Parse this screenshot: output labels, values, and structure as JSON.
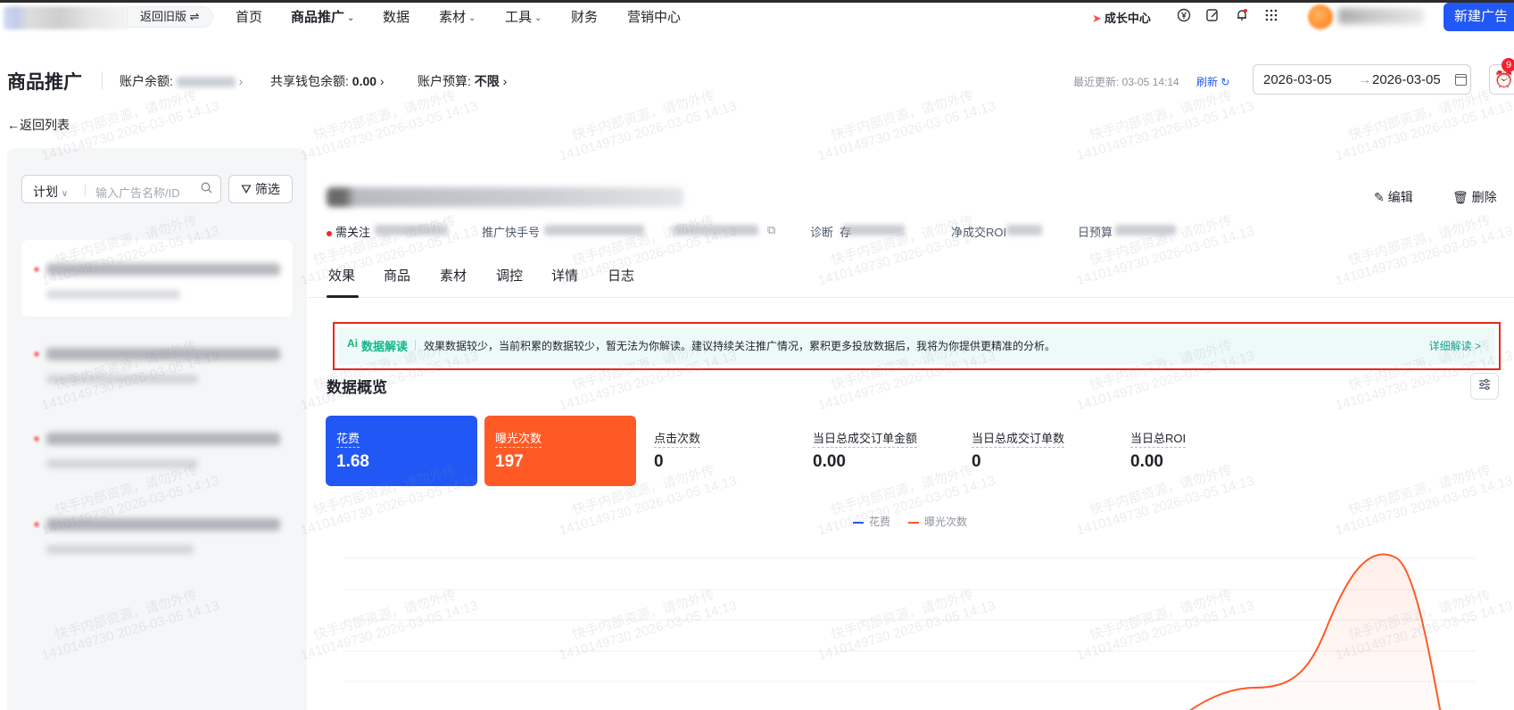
{
  "topnav": {
    "old_version": "返回旧版 ⇌",
    "items": [
      "首页",
      "商品推广",
      "数据",
      "素材",
      "工具",
      "财务",
      "营销中心"
    ],
    "growth_center": "成长中心",
    "new_ad": "新建广告"
  },
  "header": {
    "title": "商品推广",
    "account_balance_label": "账户余额:",
    "wallet_label": "共享钱包余额:",
    "wallet_value": "0.00",
    "budget_label": "账户预算:",
    "budget_value": "不限",
    "last_update": "最近更新: 03-05 14:14",
    "refresh": "刷新",
    "date_start": "2026-03-05",
    "date_end": "2026-03-05",
    "alarm_badge": "9"
  },
  "back_label": "返回列表",
  "left": {
    "search_type": "计划",
    "search_placeholder": "输入广告名称/ID",
    "filter_label": "筛选"
  },
  "detail": {
    "edit": "编辑",
    "delete": "删除",
    "status": "需关注",
    "kuaishou_label": "推广快手号",
    "diagnose_label": "诊断",
    "diagnose_prefix": "存",
    "roi_label": "净成交ROI",
    "budget_label": "日预算"
  },
  "tabs": [
    "效果",
    "商品",
    "素材",
    "调控",
    "详情",
    "日志"
  ],
  "ai": {
    "logo": "Ai",
    "title": "数据解读",
    "text": "效果数据较少，当前积累的数据较少，暂无法为你解读。建议持续关注推广情况，累积更多投放数据后，我将为你提供更精准的分析。",
    "link": "详细解读 >"
  },
  "overview": {
    "title": "数据概览",
    "metrics": [
      {
        "label": "花费",
        "value": "1.68"
      },
      {
        "label": "曝光次数",
        "value": "197"
      },
      {
        "label": "点击次数",
        "value": "0"
      },
      {
        "label": "当日总成交订单金额",
        "value": "0.00"
      },
      {
        "label": "当日总成交订单数",
        "value": "0"
      },
      {
        "label": "当日总ROI",
        "value": "0.00"
      }
    ]
  },
  "chart_data": {
    "type": "line",
    "series": [
      {
        "name": "花费",
        "color": "#2158f5"
      },
      {
        "name": "曝光次数",
        "color": "#ff5a26"
      }
    ],
    "legend": "top-center",
    "grid": true
  },
  "watermark": {
    "line1": "快手内部资源，请勿外传",
    "line2": "1410149730 2026-03-05 14:13"
  },
  "colors": {
    "primary": "#2158f5",
    "orange": "#ff5a26",
    "ai_green": "#12b886",
    "highlight_red": "#e8271b"
  }
}
